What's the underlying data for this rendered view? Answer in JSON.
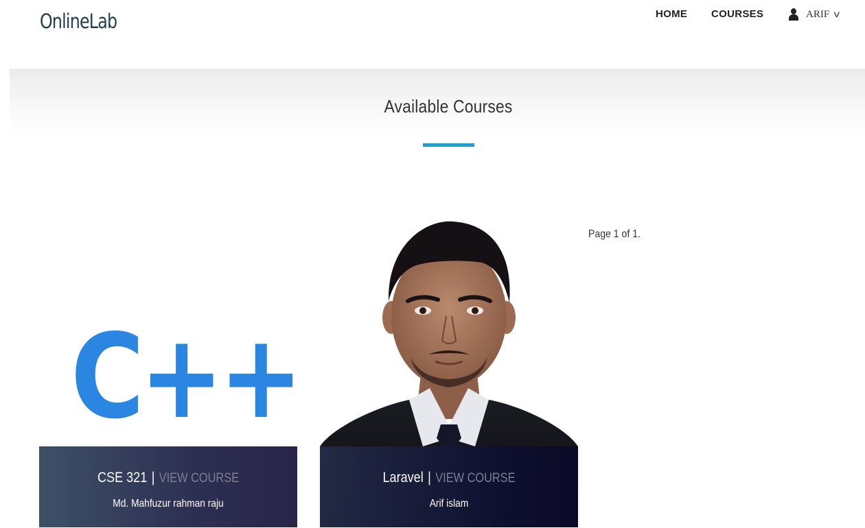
{
  "header": {
    "logo": "OnlineLab",
    "nav": {
      "home": "HOME",
      "courses": "COURSES",
      "user": "ARIF",
      "user_chevron": "∨"
    }
  },
  "banner": {
    "title": "Available Courses",
    "accent_color": "#1a9fd6"
  },
  "pagination": {
    "text": "Page 1 of 1."
  },
  "courses": [
    {
      "image_text": "C++",
      "image_color": "#2a86e0",
      "name": "CSE 321",
      "separator": "|",
      "action": "VIEW COURSE",
      "instructor": "Md. Mahfuzur rahman raju"
    },
    {
      "image_icon": "instructor-portrait",
      "name": "Laravel",
      "separator": "|",
      "action": "VIEW COURSE",
      "instructor": "Arif islam"
    }
  ]
}
